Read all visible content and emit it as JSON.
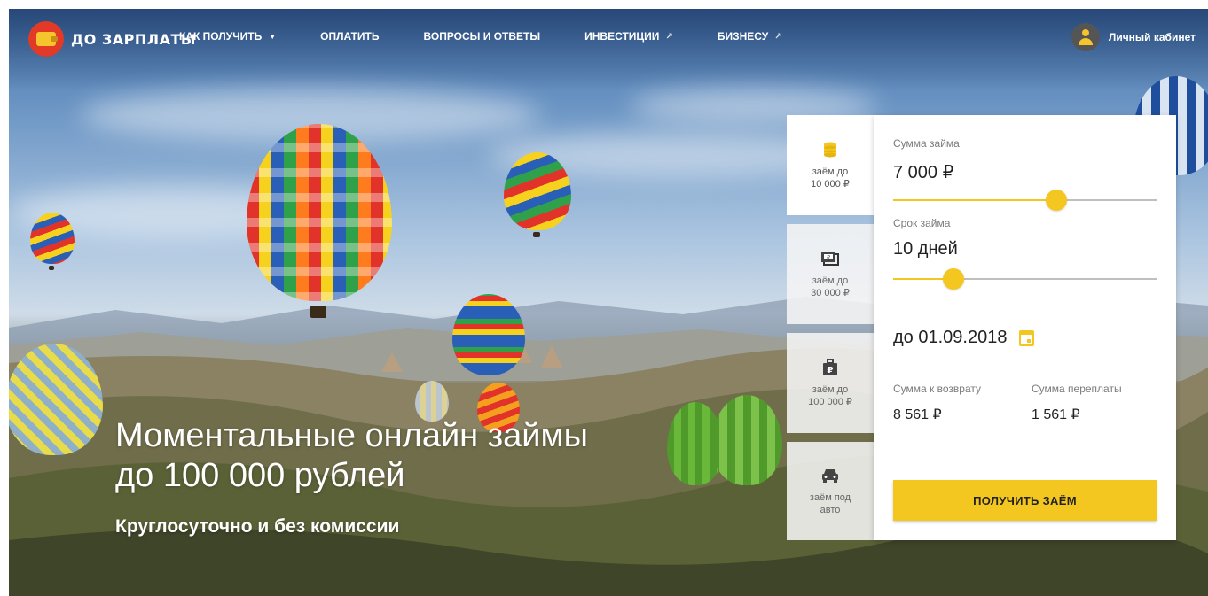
{
  "brand": {
    "name": "ДО ЗАРПЛАТЫ"
  },
  "nav": {
    "items": [
      {
        "label": "КАК ПОЛУЧИТЬ",
        "icon": "caret-down-icon"
      },
      {
        "label": "ОПЛАТИТЬ"
      },
      {
        "label": "ВОПРОСЫ И ОТВЕТЫ"
      },
      {
        "label": "ИНВЕСТИЦИИ",
        "icon": "external-link-icon"
      },
      {
        "label": "БИЗНЕСУ",
        "icon": "external-link-icon"
      }
    ],
    "account_label": "Личный кабинет"
  },
  "hero": {
    "headline_line1": "Моментальные онлайн займы",
    "headline_line2": "до 100 000 рублей",
    "subheadline": "Круглосуточно и без комиссии"
  },
  "tabs": [
    {
      "label": "заём до\n10 000 ₽",
      "icon": "coins-icon",
      "active": true
    },
    {
      "label": "заём до\n30 000 ₽",
      "icon": "banknotes-icon",
      "active": false
    },
    {
      "label": "заём до\n100 000 ₽",
      "icon": "briefcase-ruble-icon",
      "active": false
    },
    {
      "label": "заём под\nавто",
      "icon": "car-icon",
      "active": false
    }
  ],
  "calculator": {
    "amount_label": "Сумма займа",
    "amount_value": "7 000 ₽",
    "amount_fraction": 0.62,
    "term_label": "Срок займа",
    "term_value": "10 дней",
    "term_fraction": 0.23,
    "due_date": "до 01.09.2018",
    "repay_label": "Сумма к возврату",
    "repay_value": "8 561 ₽",
    "overpay_label": "Сумма переплаты",
    "overpay_value": "1 561 ₽",
    "cta_label": "ПОЛУЧИТЬ ЗАЁМ"
  },
  "colors": {
    "accent": "#f4c720",
    "logo_red": "#e23a26"
  }
}
